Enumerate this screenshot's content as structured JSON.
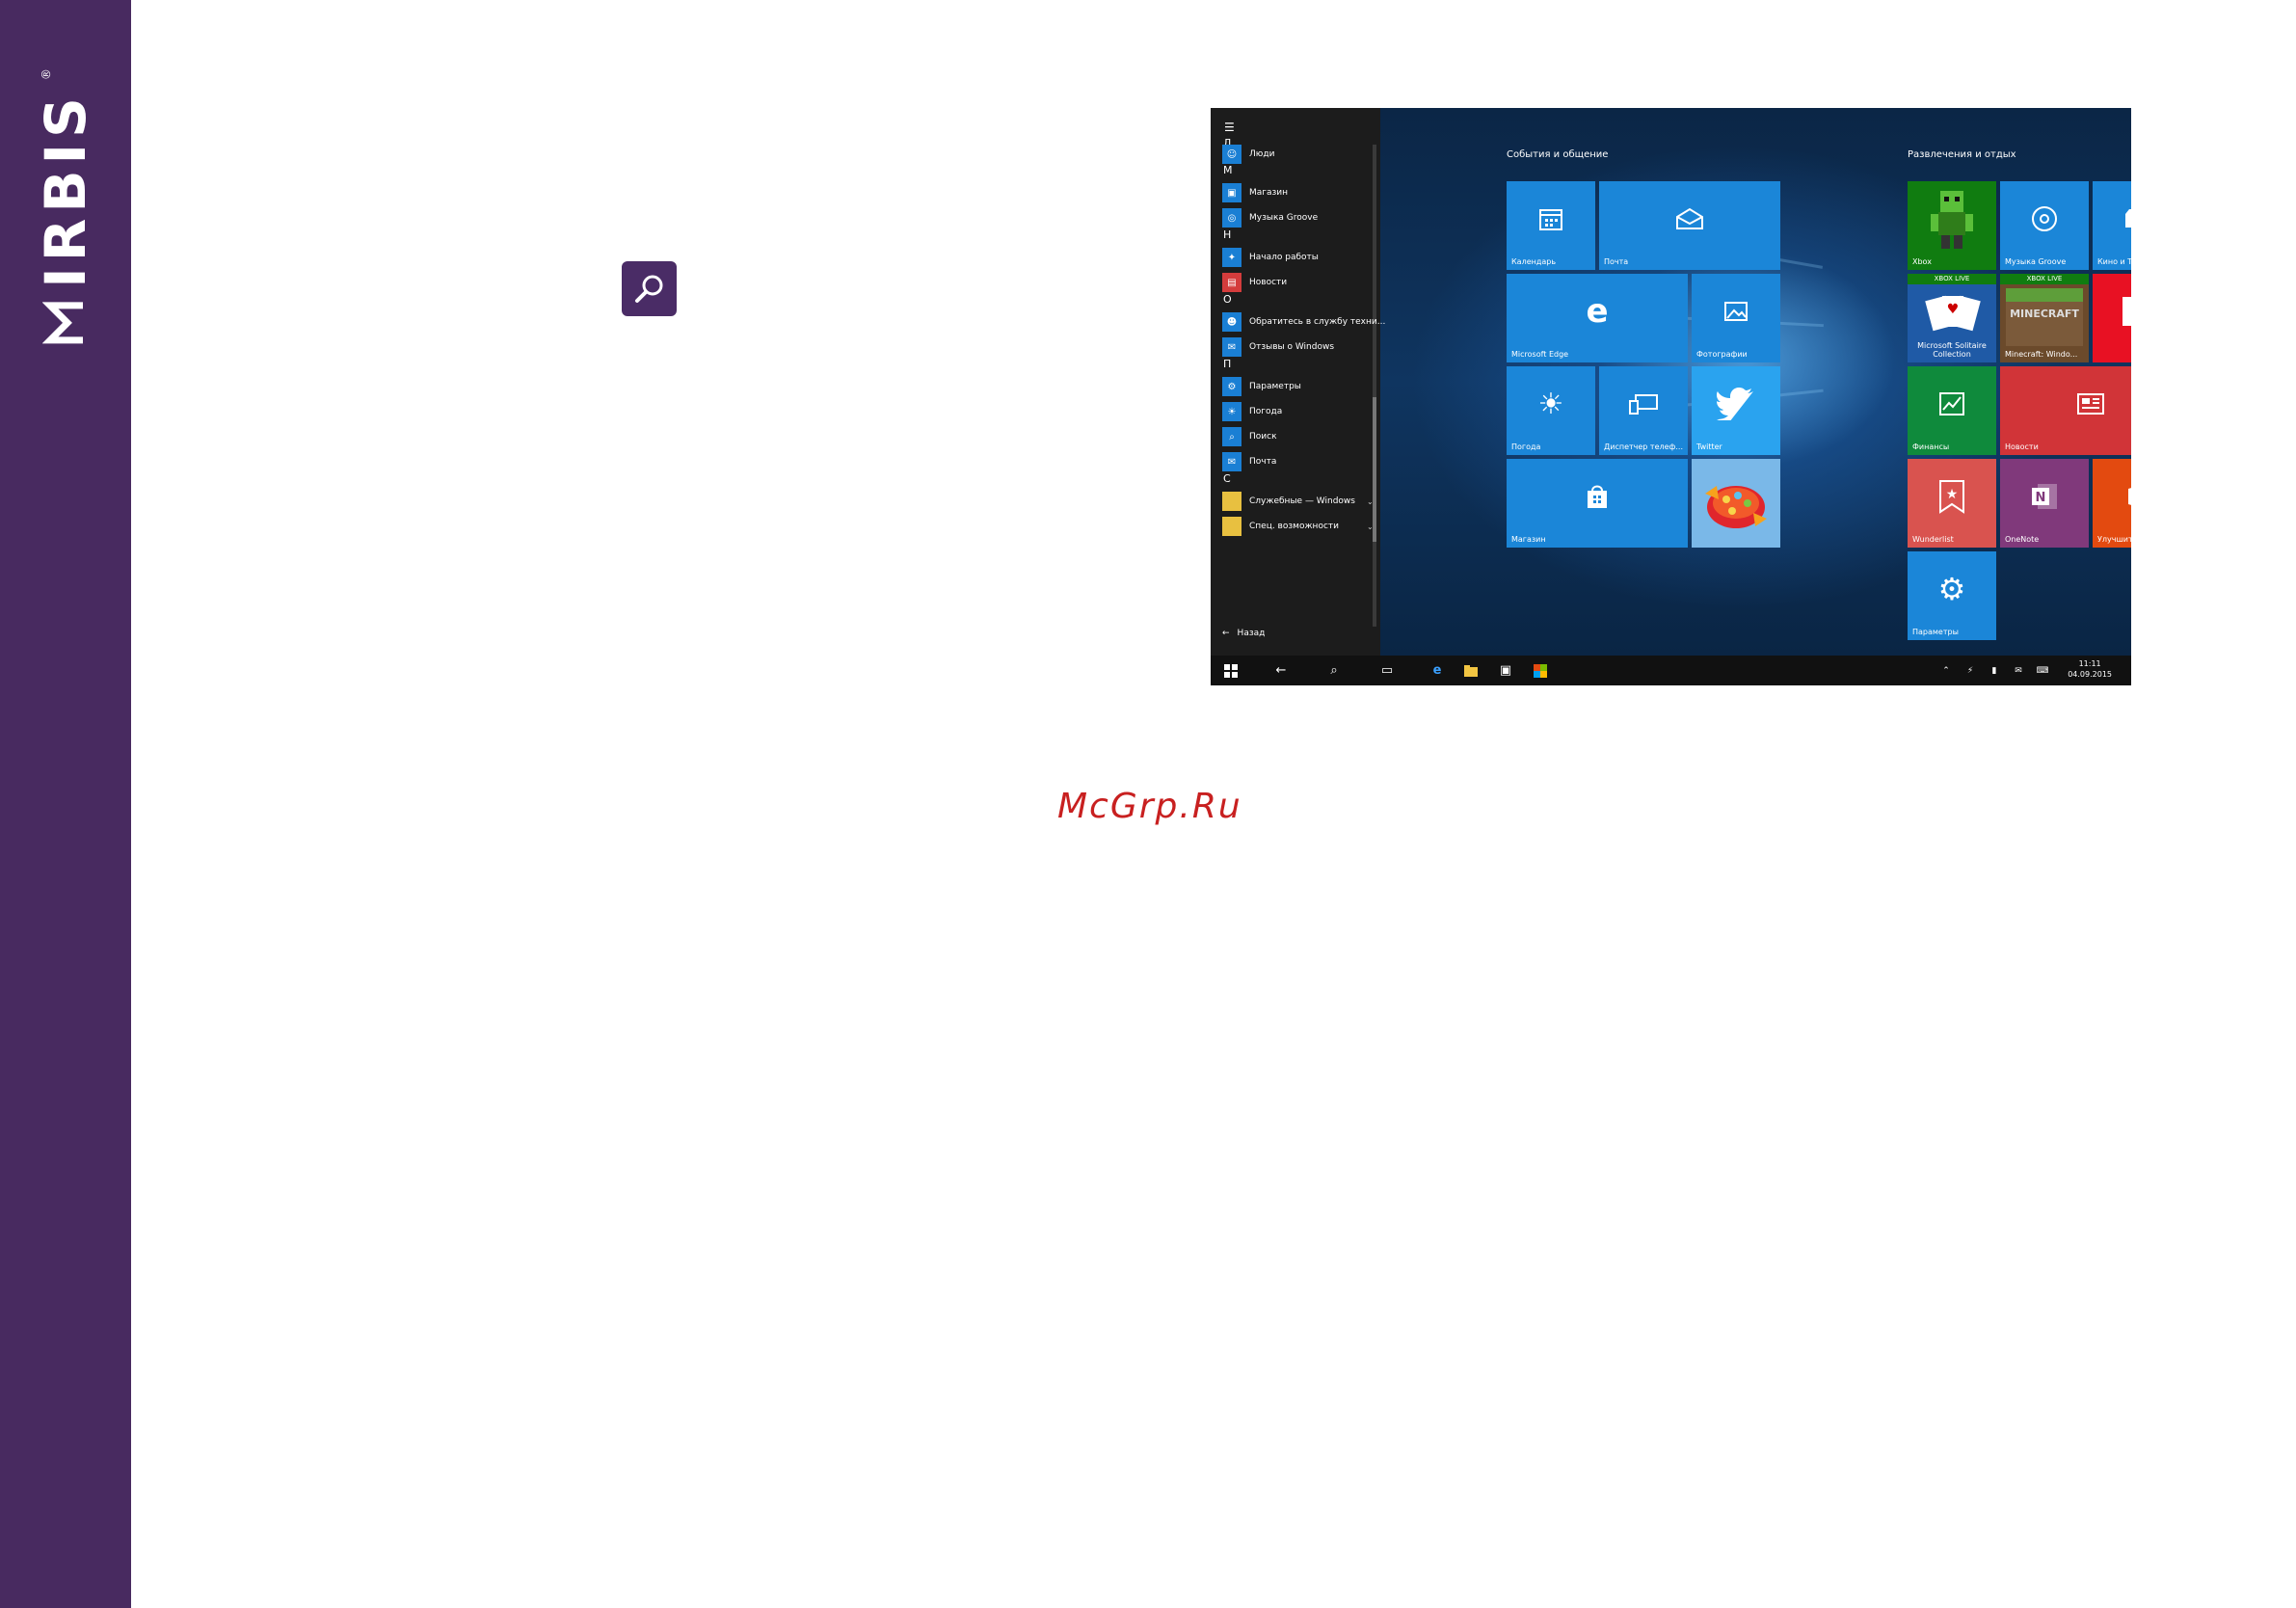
{
  "brand": {
    "name": "IRBIS",
    "reg": "®"
  },
  "watermark": "McGrp.Ru",
  "startmenu": {
    "letters": [
      "Л",
      "М",
      "Н",
      "О",
      "П",
      "С"
    ],
    "apps": [
      {
        "label": "Люди"
      },
      {
        "label": "Магазин"
      },
      {
        "label": "Музыка Groove"
      },
      {
        "label": "Начало работы"
      },
      {
        "label": "Новости"
      },
      {
        "label": "Обратитесь в службу техни..."
      },
      {
        "label": "Отзывы о Windows"
      },
      {
        "label": "Параметры"
      },
      {
        "label": "Погода"
      },
      {
        "label": "Поиск"
      },
      {
        "label": "Почта"
      },
      {
        "label": "Служебные — Windows"
      },
      {
        "label": "Спец. возможности"
      }
    ],
    "back_label": "Назад"
  },
  "groups": {
    "left_title": "События и общение",
    "right_title": "Развлечения и отдых"
  },
  "tiles": {
    "calendar": "Календарь",
    "mail": "Почта",
    "edge": "Microsoft Edge",
    "photos": "Фотографии",
    "weather": "Погода",
    "phone": "Диспетчер телеф...",
    "twitter": "Twitter",
    "store": "Магазин",
    "xbox": "Xbox",
    "xbox_live_1": "XBOX LIVE",
    "xbox_live_2": "XBOX LIVE",
    "groove": "Музыка Groove",
    "movies": "Кино и ТВ",
    "solitaire": "Microsoft Solitaire Collection",
    "minecraft": "Minecraft: Windo...",
    "finance": "Финансы",
    "news": "Новости",
    "wunderlist": "Wunderlist",
    "onenote": "OneNote",
    "office": "Улучшите...",
    "settings": "Параметры"
  },
  "taskbar": {
    "time": "11:11",
    "date": "04.09.2015"
  },
  "colors": {
    "band": "#482a60",
    "tile": "#1b86d8",
    "watermark": "#c82020"
  }
}
